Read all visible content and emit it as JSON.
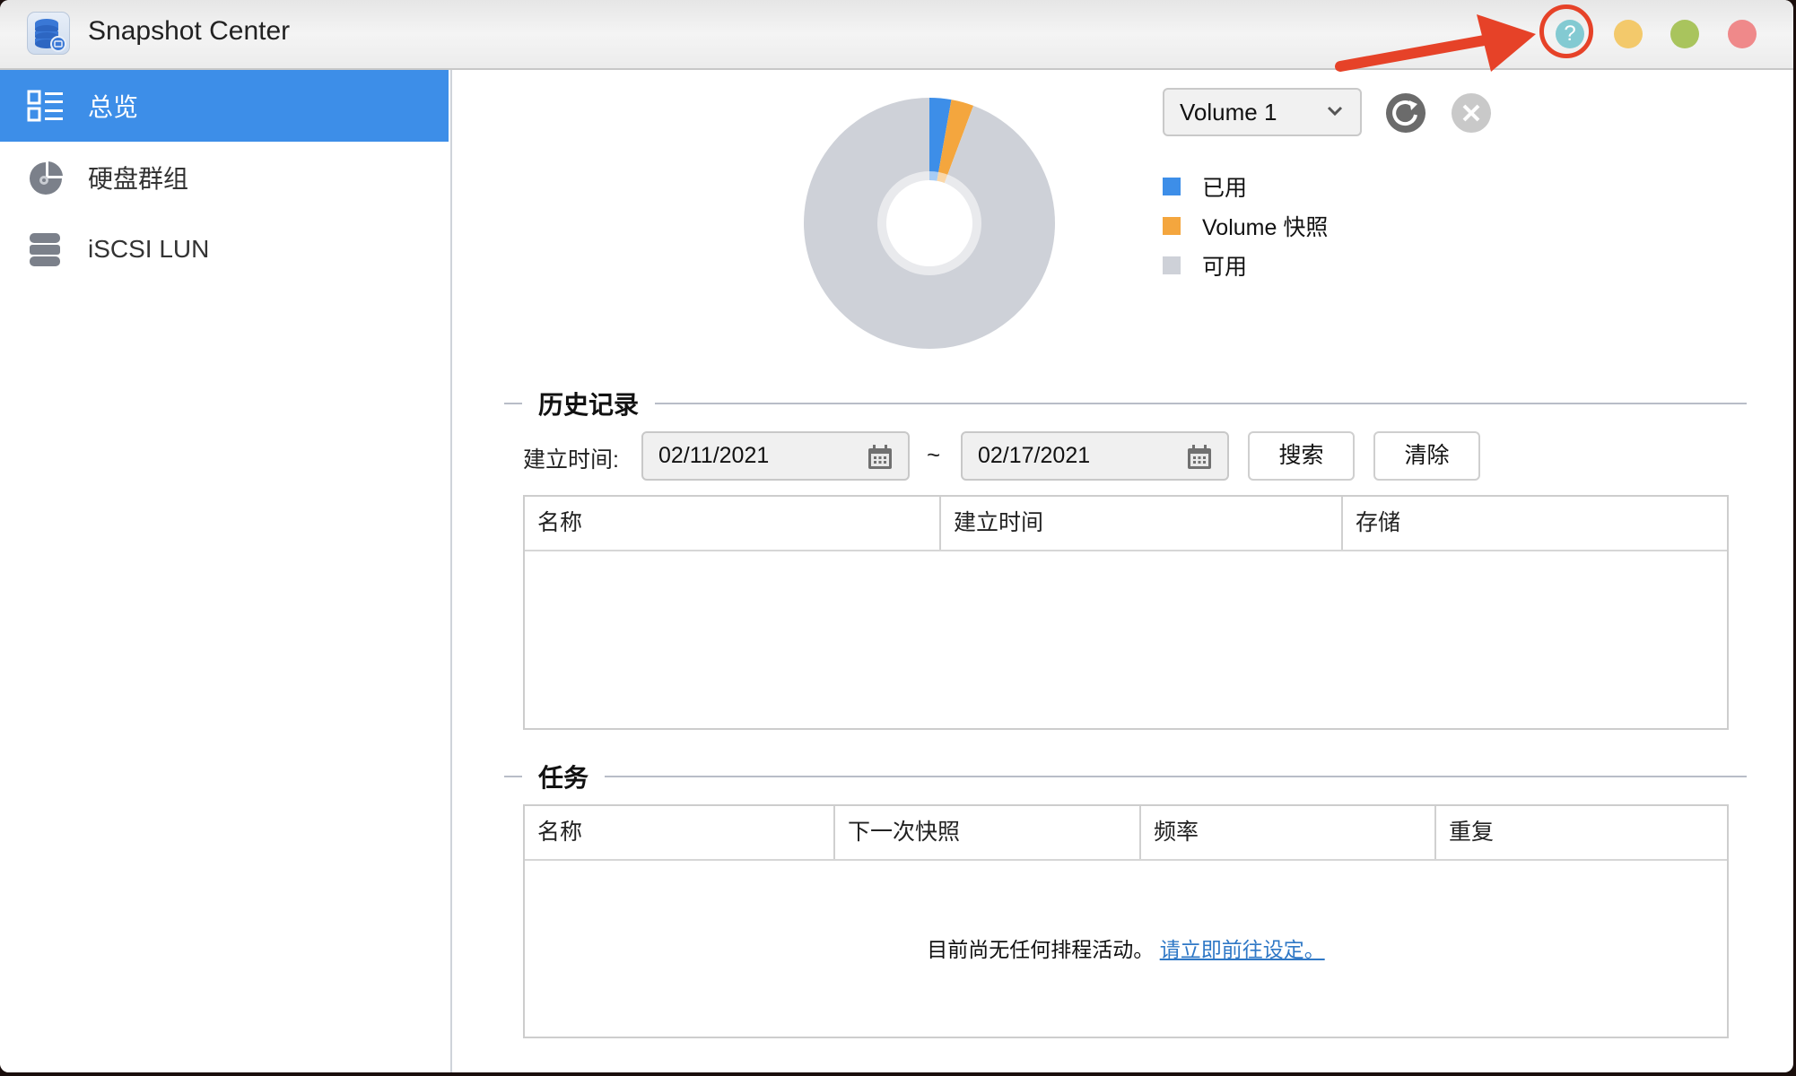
{
  "window": {
    "title": "Snapshot Center",
    "help_glyph": "?",
    "controls": [
      "help",
      "minimize",
      "maximize",
      "close"
    ],
    "annotation": "red arrow and circle highlighting the help button"
  },
  "sidebar": {
    "items": [
      {
        "label": "总览",
        "icon": "overview-list-icon",
        "active": true
      },
      {
        "label": "硬盘群组",
        "icon": "disk-group-icon",
        "active": false
      },
      {
        "label": "iSCSI LUN",
        "icon": "iscsi-database-icon",
        "active": false
      }
    ]
  },
  "overview": {
    "volume_select": {
      "selected": "Volume 1"
    },
    "refresh_icon": "refresh-icon",
    "delete_icon": "close-circle-icon",
    "legend": [
      {
        "label": "已用",
        "color": "#3d8ee8"
      },
      {
        "label": "Volume 快照",
        "color": "#f4a63e"
      },
      {
        "label": "可用",
        "color": "#ced1d8"
      }
    ]
  },
  "chart_data": {
    "type": "pie",
    "variant": "donut",
    "title": "",
    "labels": [
      "已用",
      "Volume 快照",
      "可用"
    ],
    "values": [
      2.8,
      2.9,
      94.3
    ],
    "unit": "%",
    "colors": [
      "#3d8ee8",
      "#f4a63e",
      "#ced1d8"
    ],
    "legend_position": "right"
  },
  "history": {
    "title": "历史记录",
    "filter_label": "建立时间:",
    "start_date": "02/11/2021",
    "separator": "~",
    "end_date": "02/17/2021",
    "search_label": "搜索",
    "clear_label": "清除",
    "columns": [
      "名称",
      "建立时间",
      "存储"
    ],
    "rows": []
  },
  "tasks": {
    "title": "任务",
    "columns": [
      "名称",
      "下一次快照",
      "频率",
      "重复"
    ],
    "rows": [],
    "empty_text": "目前尚无任何排程活动。",
    "empty_link": "请立即前往设定。"
  },
  "colors": {
    "accent": "#3d8ee8",
    "help": "#83cad2",
    "minimize": "#f3c96b",
    "maximize": "#a9c45d",
    "close": "#ef898a",
    "annotation": "#e64228",
    "link": "#2f78c6"
  }
}
